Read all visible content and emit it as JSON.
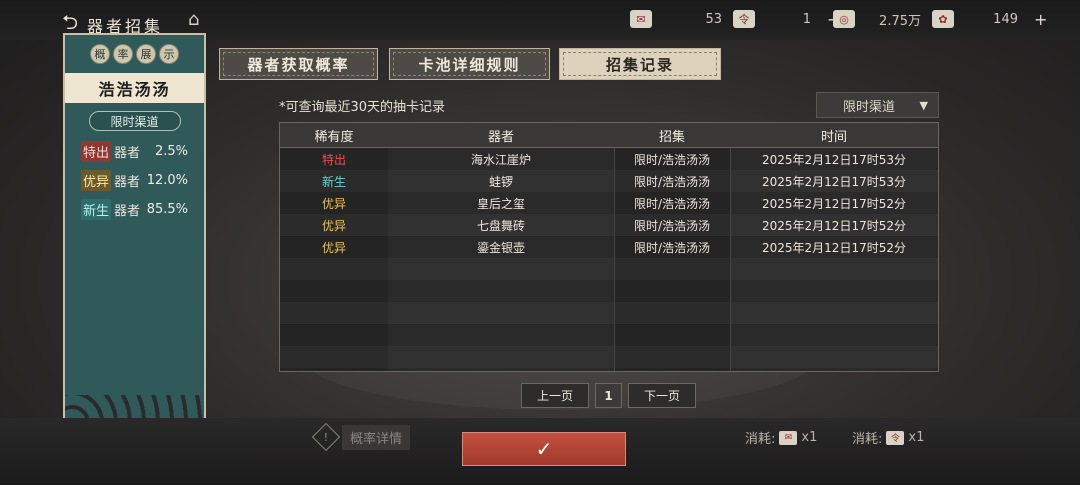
{
  "header": {
    "back_icon": "return-arrow-icon",
    "title": "器者招集",
    "home_icon": "home-icon",
    "resources": [
      {
        "icon": "letter-icon",
        "value": "53"
      },
      {
        "icon": "token-icon",
        "value": "1"
      },
      {
        "icon": "coin-icon",
        "value": "2.75万"
      },
      {
        "icon": "ornament-icon",
        "value": "149"
      }
    ],
    "plus": "+"
  },
  "left_panel": {
    "title_chars": [
      "概",
      "率",
      "展",
      "示"
    ],
    "pool_name": "浩浩汤汤",
    "channel": "限时渠道",
    "rates": [
      {
        "tag": "特出",
        "label": "器者",
        "pct": "2.5%",
        "color": "#e8514a",
        "bg": "#8e3833"
      },
      {
        "tag": "优异",
        "label": "器者",
        "pct": "12.0%",
        "color": "#f0c34a",
        "bg": "#6b5a2c"
      },
      {
        "tag": "新生",
        "label": "器者",
        "pct": "85.5%",
        "color": "#6fd0d0",
        "bg": "#2f6c6c"
      }
    ]
  },
  "tabs": [
    {
      "label": "器者获取概率",
      "active": false
    },
    {
      "label": "卡池详细规则",
      "active": false
    },
    {
      "label": "招集记录",
      "active": true
    }
  ],
  "records": {
    "note": "*可查询最近30天的抽卡记录",
    "filter": "限时渠道",
    "columns": [
      "稀有度",
      "器者",
      "招集",
      "时间"
    ],
    "rows": [
      {
        "rarity": "特出",
        "rarity_color": "#e8514a",
        "item": "海水江崖炉",
        "recruit": "限时/浩浩汤汤",
        "time": "2025年2月12日17时53分"
      },
      {
        "rarity": "新生",
        "rarity_color": "#6fd0d0",
        "item": "蛙锣",
        "recruit": "限时/浩浩汤汤",
        "time": "2025年2月12日17时53分"
      },
      {
        "rarity": "优异",
        "rarity_color": "#f0c34a",
        "item": "皇后之玺",
        "recruit": "限时/浩浩汤汤",
        "time": "2025年2月12日17时52分"
      },
      {
        "rarity": "优异",
        "rarity_color": "#f0c34a",
        "item": "七盘舞砖",
        "recruit": "限时/浩浩汤汤",
        "time": "2025年2月12日17时52分"
      },
      {
        "rarity": "优异",
        "rarity_color": "#f0c34a",
        "item": "鎏金银壶",
        "recruit": "限时/浩浩汤汤",
        "time": "2025年2月12日17时52分"
      }
    ]
  },
  "pager": {
    "prev": "上一页",
    "page": "1",
    "next": "下一页"
  },
  "footer": {
    "rate_detail": "概率详情",
    "confirm_icon": "checkmark-icon",
    "cost_label": "消耗:",
    "cost_qty": "x1"
  }
}
